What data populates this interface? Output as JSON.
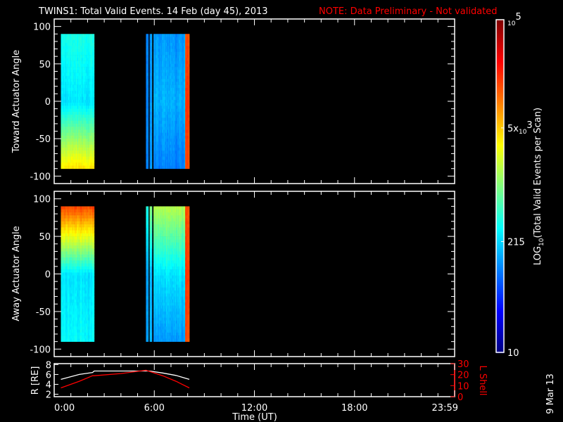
{
  "title": {
    "main": "TWINS1: Total Valid Events. 14 Feb (day  45), 2013",
    "note": "NOTE: Data Preliminary - Not validated"
  },
  "colors": {
    "background": "#000000",
    "axes": "#ffffff",
    "note": "#ff0000",
    "orbit_R": "#ffffff",
    "orbit_L": "#ff0000"
  },
  "side_label": "9 Mar 13",
  "chart_data": [
    {
      "type": "heatmap",
      "name": "toward",
      "ylabel": "Toward Actuator Angle",
      "ylim": [
        -110,
        110
      ],
      "yticks": [
        100,
        50,
        0,
        -50,
        -100
      ],
      "xlim_hours": [
        0,
        24
      ],
      "data_extent_deg": [
        -88,
        90
      ],
      "segments_log10": [
        {
          "t0": 0.4,
          "t1": 2.4,
          "top": 2.6,
          "mid": 2.4,
          "bottom": 3.6
        },
        {
          "t0": 5.5,
          "t1": 5.62,
          "top": 2.0,
          "mid": 2.0,
          "bottom": 2.0
        },
        {
          "t0": 5.72,
          "t1": 5.86,
          "top": 2.1,
          "mid": 2.1,
          "bottom": 2.1
        },
        {
          "t0": 5.95,
          "t1": 7.85,
          "top": 2.1,
          "mid": 2.2,
          "bottom": 2.0
        },
        {
          "t0": 7.85,
          "t1": 8.1,
          "top": 4.2,
          "mid": 4.3,
          "bottom": 4.2
        }
      ]
    },
    {
      "type": "heatmap",
      "name": "away",
      "ylabel": "Away Actuator Angle",
      "ylim": [
        -110,
        110
      ],
      "yticks": [
        100,
        50,
        0,
        -50,
        -100
      ],
      "xlim_hours": [
        0,
        24
      ],
      "data_extent_deg": [
        -88,
        90
      ],
      "segments_log10": [
        {
          "t0": 0.4,
          "t1": 2.4,
          "top": 4.2,
          "mid": 2.4,
          "bottom": 2.5
        },
        {
          "t0": 5.5,
          "t1": 5.62,
          "top": 2.6,
          "mid": 2.1,
          "bottom": 2.1
        },
        {
          "t0": 5.72,
          "t1": 5.86,
          "top": 3.0,
          "mid": 2.2,
          "bottom": 2.2
        },
        {
          "t0": 5.95,
          "t1": 7.85,
          "top": 3.2,
          "mid": 2.4,
          "bottom": 2.1
        },
        {
          "t0": 7.85,
          "t1": 8.1,
          "top": 4.2,
          "mid": 4.3,
          "bottom": 4.2
        }
      ]
    },
    {
      "type": "line",
      "name": "orbit",
      "ylabel": "R [RE]",
      "ylabel_right": "L Shell",
      "ylim": [
        1.5,
        8.2
      ],
      "yticks": [
        2,
        4,
        6,
        8
      ],
      "ylim_right": [
        0,
        30
      ],
      "yticks_right": [
        0,
        10,
        20,
        30
      ],
      "xlabel": "Time (UT)",
      "xticks": [
        "0:00",
        "6:00",
        "12:00",
        "18:00",
        "23:59"
      ],
      "xtick_hours": [
        0,
        6,
        12,
        18,
        24
      ],
      "series": [
        {
          "name": "R",
          "axis": "left",
          "x": [
            0.4,
            1.5,
            2.3,
            2.4,
            4.0,
            5.7,
            6.5,
            7.3,
            8.1
          ],
          "y": [
            5.0,
            6.0,
            6.4,
            6.7,
            6.7,
            6.7,
            6.3,
            5.8,
            5.0
          ]
        },
        {
          "name": "L Shell",
          "axis": "right",
          "x": [
            0.4,
            1.5,
            2.3,
            2.4,
            4.0,
            5.5,
            6.5,
            7.3,
            8.1
          ],
          "y": [
            8,
            14,
            19,
            19,
            21,
            24,
            19,
            14,
            8
          ]
        }
      ]
    },
    {
      "type": "colorbar",
      "label": "LOG10(Total Valid Events per Scan)",
      "label_prefix": "LOG",
      "label_sub": "10",
      "label_rest": "(Total Valid Events per Scan)",
      "range_log10": [
        1,
        5
      ],
      "ticks": [
        {
          "log10": 5,
          "base": "10",
          "exp": "5"
        },
        {
          "log10": 3.699,
          "pre": "5x",
          "base": "10",
          "exp": "3"
        },
        {
          "log10": 2.332,
          "text": "215"
        },
        {
          "log10": 1,
          "text": "10"
        }
      ]
    }
  ]
}
